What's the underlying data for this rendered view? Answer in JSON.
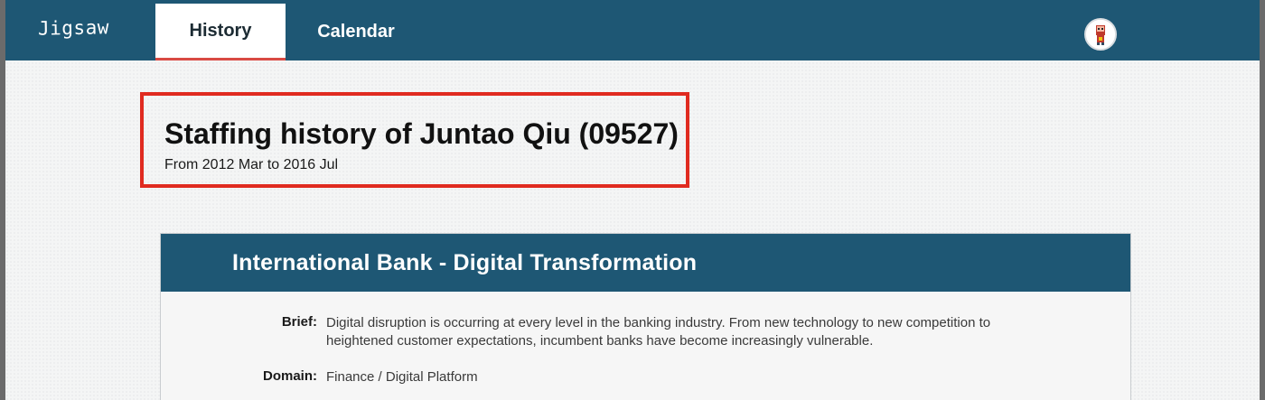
{
  "nav": {
    "logo": "Jigsaw",
    "tabs": [
      {
        "label": "History",
        "active": true
      },
      {
        "label": "Calendar",
        "active": false
      }
    ],
    "avatar_icon": "user-avatar-icon"
  },
  "header": {
    "title": "Staffing history of Juntao Qiu (09527)",
    "subtitle": "From 2012 Mar to 2016 Jul"
  },
  "project": {
    "title": "International Bank - Digital Transformation",
    "brief_label": "Brief:",
    "brief": "Digital disruption is occurring at every level in the banking industry. From new technology to new competition to heightened customer expectations, incumbent banks have become increasingly vulnerable.",
    "domain_label": "Domain:",
    "domain": "Finance / Digital Platform"
  },
  "colors": {
    "nav_bg": "#1e5774",
    "highlight_border": "#e02b20",
    "active_tab_underline": "#d94a43"
  }
}
